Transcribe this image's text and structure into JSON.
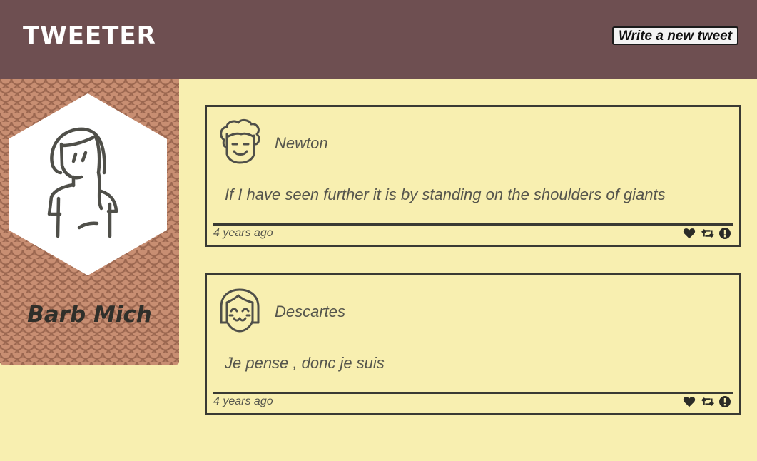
{
  "header": {
    "title": "TWEETER",
    "compose_label": "Write a new tweet"
  },
  "profile": {
    "name": "Barb Mich"
  },
  "tweets": [
    {
      "author": "Newton",
      "text": "If I have seen further it is by standing on the shoulders of giants",
      "time": "4 years ago"
    },
    {
      "author": "Descartes",
      "text": "Je pense , donc je suis",
      "time": "4 years ago"
    }
  ],
  "icons": {
    "actions": [
      "heart-icon",
      "retweet-icon",
      "flag-icon"
    ]
  },
  "colors": {
    "header_bg": "#6e4f51",
    "page_bg": "#f8efb0",
    "profile_bg": "#b07a60",
    "border": "#3a3a33"
  }
}
